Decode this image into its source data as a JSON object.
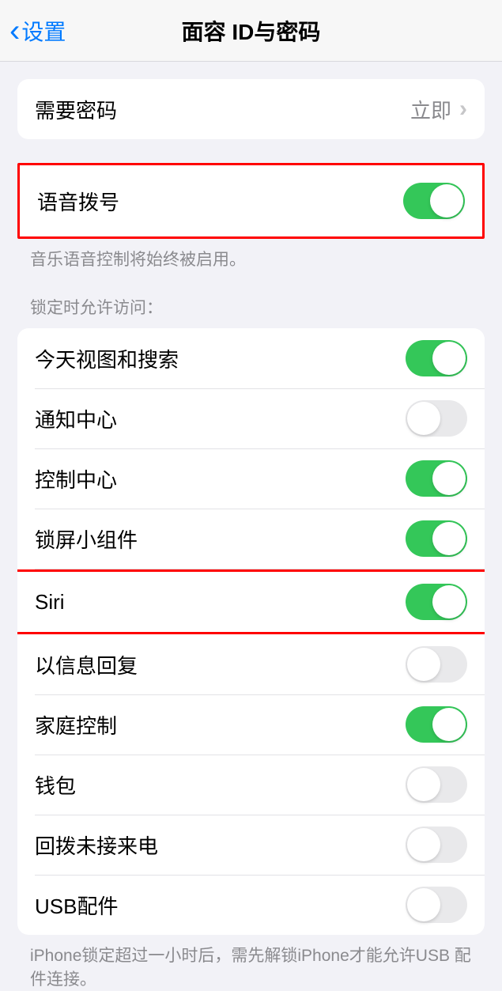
{
  "nav": {
    "back_label": "设置",
    "title": "面容 ID与密码"
  },
  "group1": {
    "require_passcode": {
      "label": "需要密码",
      "value": "立即"
    }
  },
  "group2": {
    "voice_dial": {
      "label": "语音拨号",
      "on": true
    },
    "footer": "音乐语音控制将始终被启用。"
  },
  "group3": {
    "header": "锁定时允许访问：",
    "items": [
      {
        "label": "今天视图和搜索",
        "on": true
      },
      {
        "label": "通知中心",
        "on": false
      },
      {
        "label": "控制中心",
        "on": true
      },
      {
        "label": "锁屏小组件",
        "on": true
      },
      {
        "label": "Siri",
        "on": true
      },
      {
        "label": "以信息回复",
        "on": false
      },
      {
        "label": "家庭控制",
        "on": true
      },
      {
        "label": "钱包",
        "on": false
      },
      {
        "label": "回拨未接来电",
        "on": false
      },
      {
        "label": "USB配件",
        "on": false
      }
    ],
    "footer": "iPhone锁定超过一小时后，需先解锁iPhone才能允许USB 配件连接。"
  }
}
